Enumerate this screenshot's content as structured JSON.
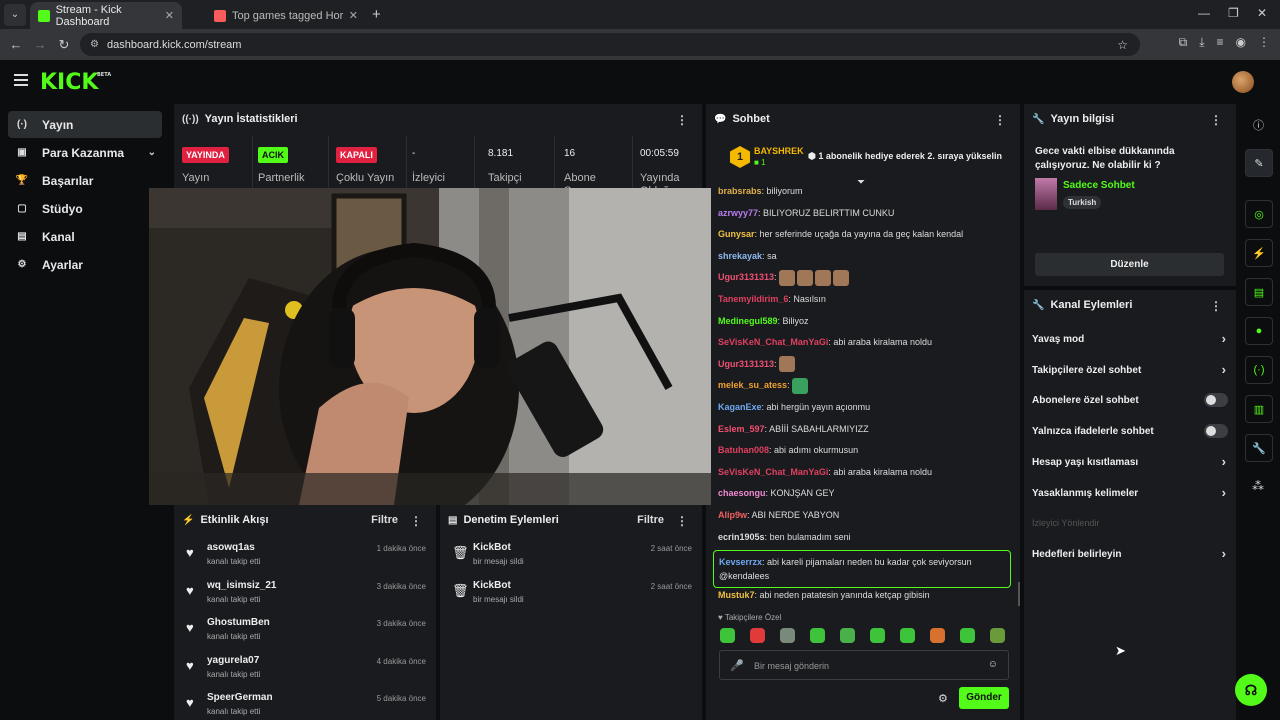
{
  "browser": {
    "tabs": [
      {
        "title": "Stream - Kick Dashboard"
      },
      {
        "title": "Top games tagged Horror - itch"
      }
    ],
    "url": "dashboard.kick.com/stream"
  },
  "header": {
    "logo": "KICK",
    "logo_beta": "BETA"
  },
  "sidebar": {
    "items": [
      {
        "label": "Yayın"
      },
      {
        "label": "Para Kazanma"
      },
      {
        "label": "Başarılar"
      },
      {
        "label": "Stüdyo"
      },
      {
        "label": "Kanal"
      },
      {
        "label": "Ayarlar"
      }
    ]
  },
  "stats": {
    "title": "Yayın İstatistikleri",
    "items": [
      {
        "badge": "YAYINDA",
        "label": "Yayın"
      },
      {
        "badge": "ACIK",
        "label": "Partnerlik"
      },
      {
        "badge": "KAPALI",
        "label": "Çoklu Yayın"
      },
      {
        "value": "-",
        "label": "İzleyici"
      },
      {
        "value": "8.181",
        "label": "Takipçi"
      },
      {
        "value": "16",
        "label": "Abone Sayısı"
      },
      {
        "value": "00:05:59",
        "label": "Yayında Olduğu"
      }
    ]
  },
  "activity": {
    "title": "Etkinlik Akışı",
    "filter": "Filtre",
    "items": [
      {
        "name": "asowq1as",
        "action": "kanalı takip etti",
        "time": "1 dakika önce"
      },
      {
        "name": "wq_isimsiz_21",
        "action": "kanalı takip etti",
        "time": "3 dakika önce"
      },
      {
        "name": "GhostumBen",
        "action": "kanalı takip etti",
        "time": "3 dakika önce"
      },
      {
        "name": "yagurela07",
        "action": "kanalı takip etti",
        "time": "4 dakika önce"
      },
      {
        "name": "SpeerGerman",
        "action": "kanalı takip etti",
        "time": "5 dakika önce"
      }
    ]
  },
  "moderation": {
    "title": "Denetim Eylemleri",
    "filter": "Filtre",
    "items": [
      {
        "name": "KickBot",
        "action": "bir mesajı sildi",
        "time": "2 saat önce"
      },
      {
        "name": "KickBot",
        "action": "bir mesajı sildi",
        "time": "2 saat önce"
      }
    ]
  },
  "chat": {
    "title": "Sohbet",
    "pinned": {
      "user": "BAYSHREK",
      "level": "1",
      "count": "1",
      "text": "1 abonelik hediye ederek 2. sıraya yükselin"
    },
    "messages": [
      {
        "user": "brabsrabs",
        "text": "biliyorum",
        "color": "#e0b04a"
      },
      {
        "user": "azrwyy77",
        "text": "BILIYORUZ BELIRTTIM CUNKU",
        "color": "#b97cf0"
      },
      {
        "user": "Gunysar",
        "text": "her seferinde uçağa da yayına da geç kalan kendal",
        "color": "#f0c040"
      },
      {
        "user": "shrekayak",
        "text": "sa",
        "color": "#8fb8f0"
      },
      {
        "user": "Ugur3131313",
        "text": "",
        "color": "#f05070",
        "emotes": 4
      },
      {
        "user": "Tanemyildirim_6",
        "text": "Nasılsın",
        "color": "#e04060"
      },
      {
        "user": "Medinegul589",
        "text": "Biliyoz",
        "color": "#53fc18"
      },
      {
        "user": "SeVisKeN_Chat_ManYaGi",
        "text": "abi araba kiralama noldu",
        "color": "#e04060"
      },
      {
        "user": "Ugur3131313",
        "text": "",
        "color": "#f05070",
        "emotes": 1
      },
      {
        "user": "melek_su_atess",
        "text": "",
        "color": "#f0a030",
        "emotes": 1
      },
      {
        "user": "KaganExe",
        "text": "abi hergün yayın açıonmu",
        "color": "#6fa8f0"
      },
      {
        "user": "Eslem_597",
        "text": "ABİİİ SABAHLARMIYIZZ",
        "color": "#f05070"
      },
      {
        "user": "Batuhan008",
        "text": "abi adımı okurmusun",
        "color": "#e04060"
      },
      {
        "user": "SeVisKeN_Chat_ManYaGi",
        "text": "abi araba kiralama noldu",
        "color": "#e04060"
      },
      {
        "user": "chaesongu",
        "text": "KONJŞAN GEY",
        "color": "#f08ad0"
      },
      {
        "user": "Alip9w",
        "text": "ABI NERDE YABYON",
        "color": "#f06060"
      },
      {
        "user": "ecrin1905s",
        "text": "ben bulamadım seni",
        "color": "#dddddd"
      },
      {
        "user": "Kevserrzx",
        "text": "abi kareli pijamaları neden bu kadar çok seviyorsun @kendalees",
        "color": "#6fa8f0",
        "highlight": true
      },
      {
        "user": "Mustuk7",
        "text": "abi neden patatesin yanında ketçap gibisin",
        "color": "#f0c040"
      }
    ],
    "mode_label": "Takipçilere Özel",
    "input_placeholder": "Bir mesaj gönderin",
    "send_label": "Gönder"
  },
  "stream_info": {
    "title": "Yayın bilgisi",
    "stream_title": "Gece vakti elbise dükkanında çalışıyoruz. Ne olabilir ki ?",
    "category": "Sadece Sohbet",
    "tag": "Turkish",
    "edit_label": "Düzenle"
  },
  "channel_actions": {
    "title": "Kanal Eylemleri",
    "items": [
      {
        "label": "Yavaş mod",
        "kind": "arrow"
      },
      {
        "label": "Takipçilere özel sohbet",
        "kind": "arrow"
      },
      {
        "label": "Abonelere özel sohbet",
        "kind": "toggle"
      },
      {
        "label": "Yalnızca ifadelerle sohbet",
        "kind": "toggle"
      },
      {
        "label": "Hesap yaşı kısıtlaması",
        "kind": "arrow"
      },
      {
        "label": "Yasaklanmış kelimeler",
        "kind": "arrow"
      },
      {
        "label": "İzleyici Yönlendir",
        "kind": "disabled"
      },
      {
        "label": "Hedefleri belirleyin",
        "kind": "arrow"
      }
    ]
  },
  "colors": {
    "accent": "#53fc18",
    "live": "#e0213f",
    "panel": "#191b1f",
    "bg": "#0b0d0e"
  }
}
